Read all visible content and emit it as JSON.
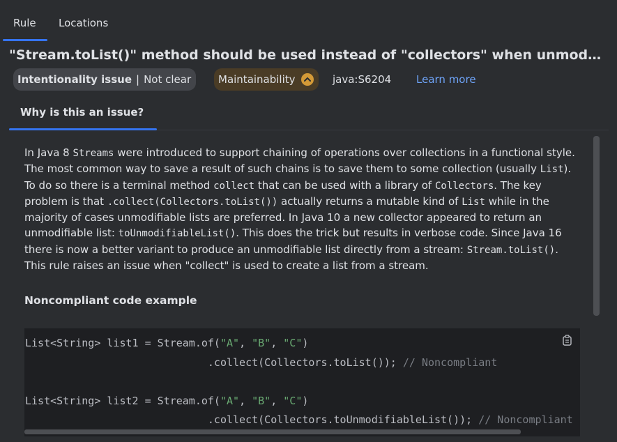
{
  "tabs": [
    {
      "label": "Rule"
    },
    {
      "label": "Locations"
    }
  ],
  "rule": {
    "title": "\"Stream.toList()\" method should be used instead of \"collectors\" when unmodifiable list needed",
    "impact_strong": "Intentionality issue",
    "impact_weak": "Not clear",
    "quality": "Maintainability",
    "key": "java:S6204",
    "learn_more": "Learn more"
  },
  "section": {
    "tab_label": "Why is this an issue?"
  },
  "description": {
    "p1a": "In Java 8 ",
    "c1": "Streams",
    "p1b": " were introduced to support chaining of operations over collections in a functional style. The most common way to save a result of such chains is to save them to some collection (usually ",
    "c2": "List",
    "p1c": "). To do so there is a terminal method ",
    "c3": "collect",
    "p1d": " that can be used with a library of ",
    "c4": "Collectors",
    "p1e": ". The key problem is that ",
    "c5": ".collect(Collectors.toList())",
    "p1f": " actually returns a mutable kind of ",
    "c6": "List",
    "p1g": " while in the majority of cases unmodifiable lists are preferred. In Java 10 a new collector appeared to return an unmodifiable list: ",
    "c7": "toUnmodifiableList()",
    "p1h": ". This does the trick but results in verbose code. Since Java 16 there is now a better variant to produce an unmodifiable list directly from a stream: ",
    "c8": "Stream.toList()",
    "p1i": ".",
    "p2": "This rule raises an issue when \"collect\" is used to create a list from a stream."
  },
  "noncompliant_heading": "Noncompliant code example",
  "code": {
    "l1a": "List<String> list1 = Stream.of(",
    "l1s1": "\"A\"",
    "l1c1": ", ",
    "l1s2": "\"B\"",
    "l1c2": ", ",
    "l1s3": "\"C\"",
    "l1e": ")",
    "l2a": "                             .collect(Collectors.toList()); ",
    "l2cmt": "// Noncompliant",
    "l4a": "List<String> list2 = Stream.of(",
    "l4s1": "\"A\"",
    "l4c1": ", ",
    "l4s2": "\"B\"",
    "l4c2": ", ",
    "l4s3": "\"C\"",
    "l4e": ")",
    "l5a": "                             .collect(Collectors.toUnmodifiableList()); ",
    "l5cmt": "// Noncompliant"
  },
  "colors": {
    "accent": "#3574f0",
    "link": "#6ea3f7",
    "quality_icon": "#d49a37",
    "string": "#6aab73",
    "comment": "#7a7e85"
  },
  "icons": {
    "quality": "chevron-up-icon",
    "copy": "copy-icon"
  }
}
